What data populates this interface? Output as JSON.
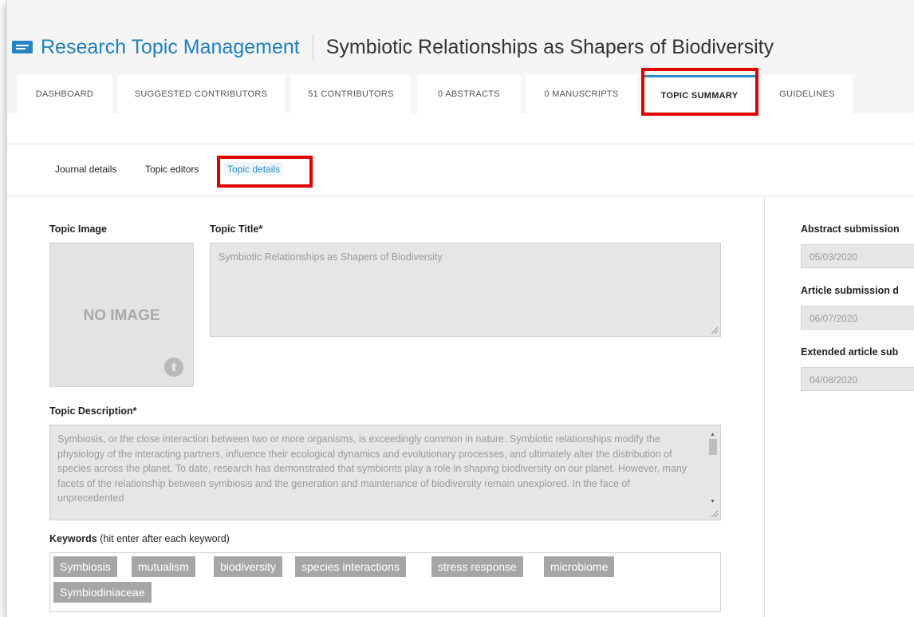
{
  "header": {
    "app_title": "Research Topic Management",
    "topic_title": "Symbiotic Relationships as Shapers of Biodiversity"
  },
  "tabs": [
    {
      "label": "DASHBOARD"
    },
    {
      "label": "SUGGESTED CONTRIBUTORS"
    },
    {
      "label": "51 CONTRIBUTORS"
    },
    {
      "label": "0 ABSTRACTS"
    },
    {
      "label": "0 MANUSCRIPTS"
    },
    {
      "label": "TOPIC SUMMARY",
      "active": true
    },
    {
      "label": "GUIDELINES"
    }
  ],
  "subnav": [
    {
      "label": "Journal details"
    },
    {
      "label": "Topic editors"
    },
    {
      "label": "Topic details",
      "active": true
    }
  ],
  "form": {
    "topic_image_label": "Topic Image",
    "no_image_text": "NO IMAGE",
    "topic_title_label": "Topic Title*",
    "topic_title_value": "Symbiotic Relationships as Shapers of Biodiversity",
    "topic_description_label": "Topic Description*",
    "topic_description_value": "Symbiosis, or the close interaction between two or more organisms, is exceedingly common in nature. Symbiotic relationships modify the physiology of the interacting partners, influence their ecological dynamics and evolutionary processes, and ultimately alter the distribution of species across the planet. To date, research has demonstrated that symbionts play a role in shaping biodiversity on our planet. However, many facets of the relationship between symbiosis and the generation and maintenance of biodiversity remain unexplored. In the face of unprecedented",
    "keywords_label": "Keywords",
    "keywords_note": "(hit enter after each keyword)",
    "keywords": [
      "Symbiosis",
      "mutualism",
      "biodiversity",
      "species interactions",
      "stress response",
      "microbiome",
      "Symbiodiniaceae"
    ]
  },
  "dates": {
    "abstract_label": "Abstract submission",
    "abstract_value": "05/03/2020",
    "article_label": "Article submission d",
    "article_value": "06/07/2020",
    "extended_label": "Extended article sub",
    "extended_value": "04/08/2020"
  },
  "colors": {
    "accent": "#2a8ec8",
    "app_title": "#1f7fbf",
    "highlight": "#e00000",
    "chip": "#a6a6a6"
  }
}
